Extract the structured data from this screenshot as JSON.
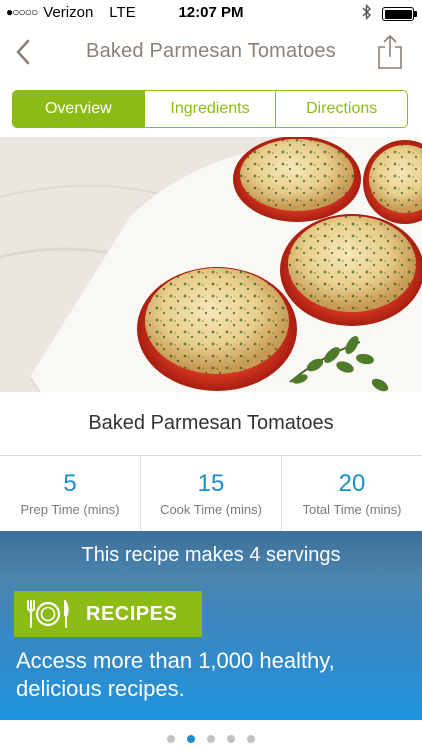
{
  "status_bar": {
    "signal_dots": "●○○○○",
    "carrier": "Verizon",
    "network": "LTE",
    "time": "12:07 PM",
    "bluetooth_icon": "bluetooth-icon",
    "battery_icon": "battery-icon"
  },
  "nav": {
    "title": "Baked Parmesan Tomatoes",
    "back_icon": "chevron-left-icon",
    "share_icon": "share-icon"
  },
  "tabs": [
    {
      "label": "Overview",
      "active": true
    },
    {
      "label": "Ingredients",
      "active": false
    },
    {
      "label": "Directions",
      "active": false
    }
  ],
  "recipe": {
    "title": "Baked Parmesan Tomatoes",
    "stats": [
      {
        "value": "5",
        "label": "Prep Time (mins)"
      },
      {
        "value": "15",
        "label": "Cook Time (mins)"
      },
      {
        "value": "20",
        "label": "Total Time (mins)"
      }
    ],
    "servings_text": "This recipe makes 4 servings"
  },
  "promo": {
    "badge_label": "RECIPES",
    "badge_icon": "plate-cutlery-icon",
    "text": "Access more than 1,000 healthy, delicious recipes."
  },
  "pager": {
    "count": 5,
    "active_index": 1
  },
  "colors": {
    "accent_green": "#8dbb15",
    "accent_blue": "#1a8ec9",
    "title_brown": "#8c8077"
  }
}
